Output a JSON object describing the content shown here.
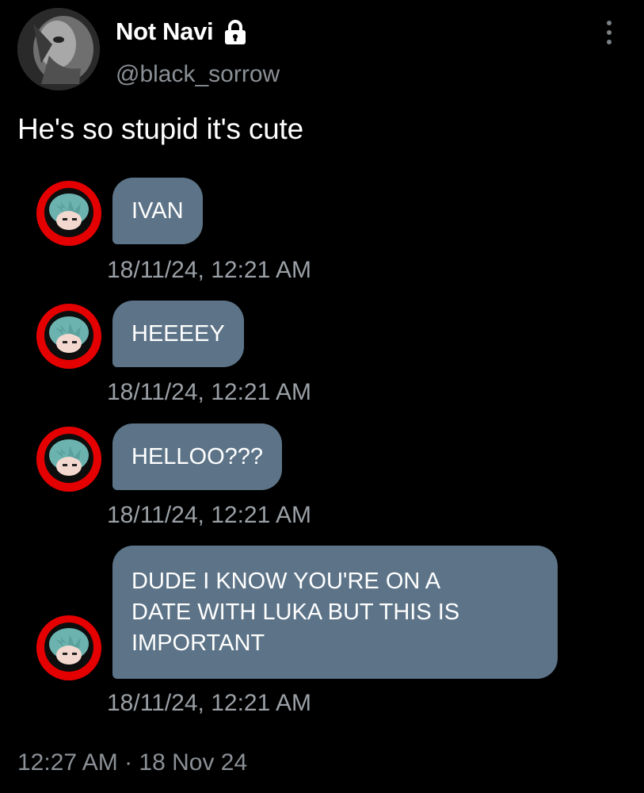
{
  "author": {
    "display_name": "Not Navi",
    "handle": "@black_sorrow",
    "protected_icon": "lock-icon",
    "menu_icon": "more-vertical-icon"
  },
  "tweet": {
    "text": "He's so stupid it's cute",
    "timestamp": "12:27 AM · 18 Nov 24"
  },
  "messages": [
    {
      "text": "IVAN",
      "time": "18/11/24, 12:21 AM"
    },
    {
      "text": "HEEEEY",
      "time": "18/11/24, 12:21 AM"
    },
    {
      "text": "HELLOO???",
      "time": "18/11/24, 12:21 AM"
    },
    {
      "text": "DUDE I KNOW YOU'RE ON A\nDATE WITH LUKA BUT THIS IS\nIMPORTANT",
      "time": "18/11/24, 12:21 AM"
    }
  ],
  "colors": {
    "background": "#000000",
    "bubble": "#5d7488",
    "avatar_ring": "#e40000",
    "muted_text": "#8b9096"
  }
}
